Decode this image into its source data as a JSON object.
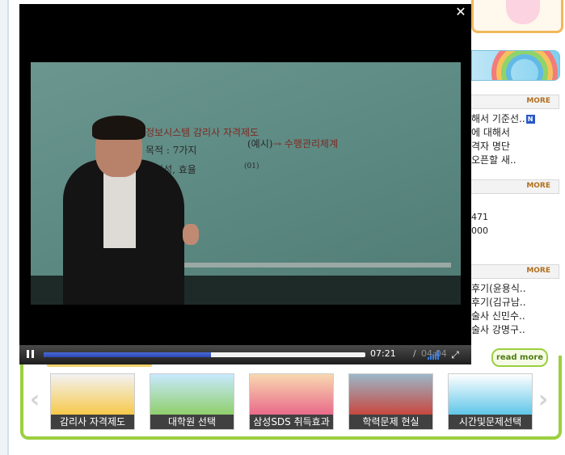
{
  "background_page": {
    "more_label": "MORE",
    "notices": [
      "해서 기준선..",
      "에 대해서",
      "격자 명단",
      "오픈할 새.."
    ],
    "new_badge": "N",
    "numbers": [
      "471",
      "000"
    ],
    "reviews": [
      "후기(윤용식..",
      "후기(김규남..",
      "술사 신민수..",
      "술사 강명구.."
    ]
  },
  "player": {
    "close_label": "✕",
    "board_text": [
      "※정보시스템 감리사 자격제도",
      "목적 : 7가지",
      "신뢰성, 효율",
      "→ 수행관리체계",
      "(예시)",
      "(01)"
    ],
    "time_current": "07:21",
    "time_separator": "/",
    "time_total": "04:04",
    "progress": 0.52,
    "fullscreen_icon": "⤢"
  },
  "carousel": {
    "read_more_label": "read more",
    "prev_arrow": "‹",
    "next_arrow": "›",
    "items": [
      {
        "caption": "감리사 자격제도",
        "color": "#f7c94a"
      },
      {
        "caption": "대학원 선택",
        "color": "#8fcf6b"
      },
      {
        "caption": "삼성SDS 취득효과",
        "color": "#e96a8a"
      },
      {
        "caption": "학력문제 현실",
        "color": "#c7473f"
      },
      {
        "caption": "시간및문제선택",
        "color": "#5fc6e8"
      }
    ]
  }
}
